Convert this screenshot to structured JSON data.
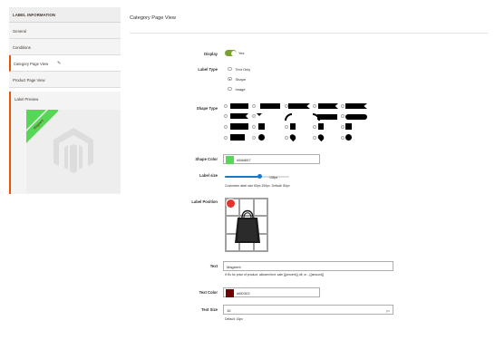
{
  "sidebar": {
    "header": "LABEL INFORMATION",
    "items": [
      {
        "label": "General"
      },
      {
        "label": "Conditions"
      },
      {
        "label": "Category Page View"
      },
      {
        "label": "Product Page View"
      }
    ],
    "preview_title": "Label Preview",
    "preview_label_text": "Magirent"
  },
  "main": {
    "title": "Category Page View",
    "display": {
      "label": "Display",
      "value_text": "Yes",
      "on": true
    },
    "label_type": {
      "label": "Label Type",
      "options": [
        "Text Only",
        "Shape",
        "Image"
      ],
      "selected": "Shape"
    },
    "shape_type": {
      "label": "Shape Type"
    },
    "shape_color": {
      "label": "Shape Color",
      "value": "#58d657",
      "swatch": "#58d657"
    },
    "label_size": {
      "label": "Label size",
      "value_text": "135px",
      "note": "Customize label size 60px-150px. Default: 80px",
      "value": 135,
      "min": 60,
      "max": 150
    },
    "label_position": {
      "label": "Label Position",
      "selected_cell": "top-left"
    },
    "text": {
      "label": "Text",
      "value": "Magirent",
      "note": "If it's for price of product, allowed text: sale {{percent}} off, or - {{amount}}"
    },
    "text_color": {
      "label": "Text Color",
      "value": "#6f0303",
      "swatch": "#6f0303"
    },
    "text_size": {
      "label": "Text Size",
      "value": "16",
      "unit": "px",
      "note": "Default: 16px"
    }
  },
  "colors": {
    "accent": "#eb5202",
    "toggle_on": "#79a22e",
    "slider": "#1979c3",
    "preview_ribbon": "#58d657",
    "magento_logo": "#f26322"
  },
  "icons": [
    "pencil-icon",
    "magento-logo-icon",
    "tote-bag-icon",
    "position-marker-icon"
  ]
}
